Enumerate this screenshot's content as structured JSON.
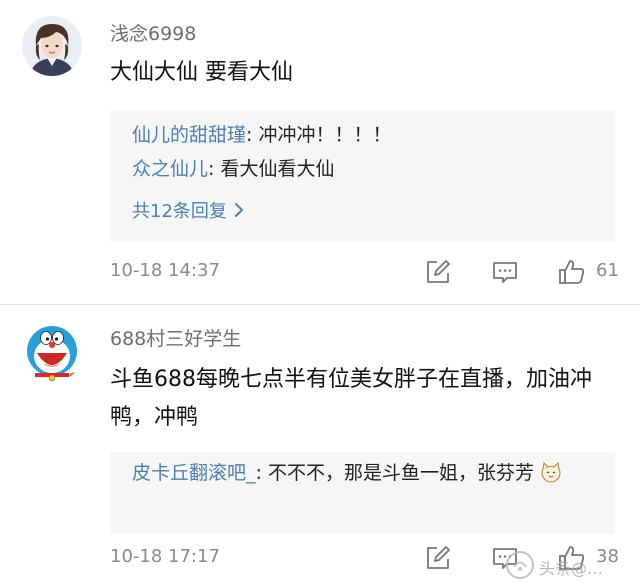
{
  "comments": [
    {
      "username": "浅念6998",
      "text": "大仙大仙 要看大仙",
      "replies": [
        {
          "name": "仙儿的甜甜瑾",
          "separator": ": ",
          "text": "冲冲冲！！！！"
        },
        {
          "name": "众之仙儿",
          "separator": ": ",
          "text": "看大仙看大仙"
        }
      ],
      "more_replies": "共12条回复 ",
      "more_icon": "chevron-right-icon",
      "timestamp": "10-18 14:37",
      "likes": "61"
    },
    {
      "username": "688村三好学生",
      "text": "斗鱼688每晚七点半有位美女胖子在直播，加油冲鸭，冲鸭",
      "replies": [
        {
          "name": "皮卡丘翻滚吧_",
          "separator": ": ",
          "text": "不不不，那是斗鱼一姐，张芬芳"
        }
      ],
      "timestamp": "10-18 17:17",
      "likes": "38"
    }
  ],
  "watermark": {
    "text": "头条@…"
  },
  "icons": {
    "edit": "edit-icon",
    "comment": "comment-icon",
    "like": "thumbs-up-icon",
    "emoji": "cat-emoji-icon"
  },
  "colors": {
    "link": "#4f7fb0",
    "meta": "#8a8a8a",
    "reply_bg": "#f6f6f6"
  }
}
